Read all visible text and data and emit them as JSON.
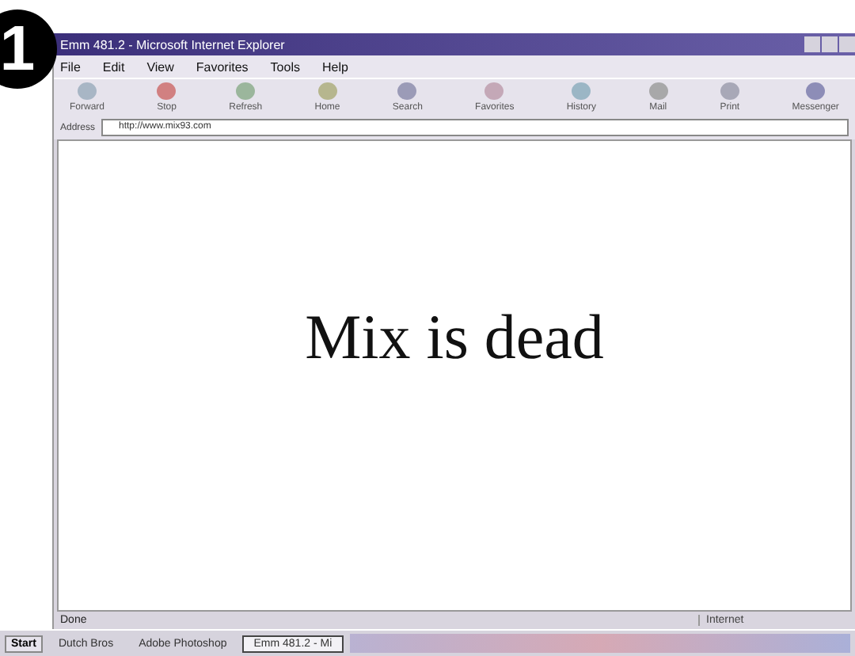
{
  "badge": "1",
  "window": {
    "title": "Emm 481.2 - Microsoft Internet Explorer"
  },
  "menu": [
    "File",
    "Edit",
    "View",
    "Favorites",
    "Tools",
    "Help"
  ],
  "toolbar": [
    {
      "label": "Forward",
      "kind": "forward"
    },
    {
      "label": "Stop",
      "kind": "stop"
    },
    {
      "label": "Refresh",
      "kind": "refresh"
    },
    {
      "label": "Home",
      "kind": "home"
    },
    {
      "label": "Search",
      "kind": "search"
    },
    {
      "label": "Favorites",
      "kind": "favorites"
    },
    {
      "label": "History",
      "kind": "history"
    },
    {
      "label": "Mail",
      "kind": "mail"
    },
    {
      "label": "Print",
      "kind": "print"
    },
    {
      "label": "Messenger",
      "kind": "messenger"
    }
  ],
  "address": {
    "label": "Address",
    "value": "http://www.mix93.com"
  },
  "page": {
    "headline": "Mix is dead"
  },
  "status_bar": {
    "text": "Done",
    "zone": "Internet"
  },
  "taskbar": {
    "start": "Start",
    "items": [
      {
        "label": "Dutch Bros",
        "selected": false
      },
      {
        "label": "Adobe Photoshop",
        "selected": false
      },
      {
        "label": "Emm 481.2 - Mi",
        "selected": true
      }
    ]
  }
}
